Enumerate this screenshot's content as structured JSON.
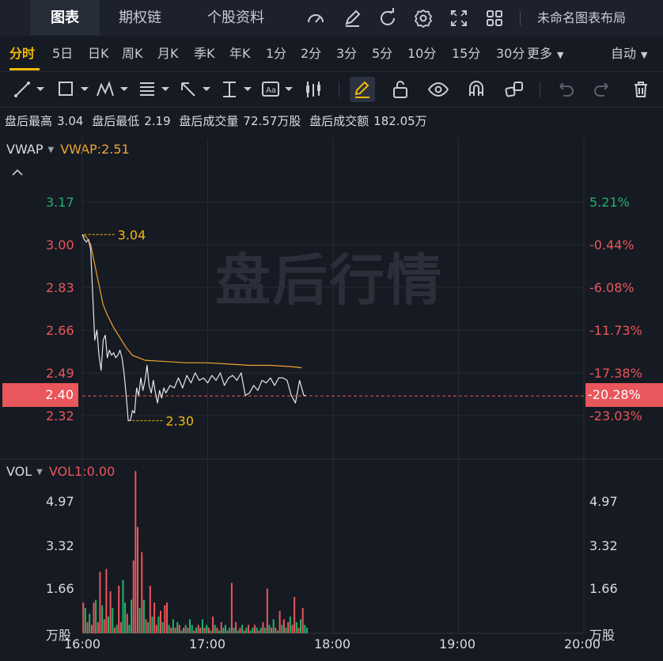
{
  "tabs": [
    {
      "label": "图表",
      "active": true
    },
    {
      "label": "期权链",
      "active": false
    },
    {
      "label": "个股资料",
      "active": false
    }
  ],
  "layout_name": "未命名图表布局",
  "periods": [
    "分时",
    "5日",
    "日K",
    "周K",
    "月K",
    "季K",
    "年K",
    "1分",
    "2分",
    "3分",
    "5分",
    "10分",
    "15分",
    "30分",
    "更多"
  ],
  "active_period": "分时",
  "mode_label": "自动",
  "info": {
    "high_label": "盘后最高",
    "high": "3.04",
    "low_label": "盘后最低",
    "low": "2.19",
    "vol_label": "盘后成交量",
    "vol": "72.57万股",
    "amt_label": "盘后成交额",
    "amt": "182.05万"
  },
  "watermark": "盘后行情",
  "price_legend": {
    "name": "VWAP",
    "value_text": "VWAP:2.51"
  },
  "vol_legend": {
    "name": "VOL",
    "value_text": "VOL1:0.00"
  },
  "colors": {
    "up": "#e9565b",
    "down": "#20b26c",
    "vwap": "#f0a330",
    "price": "#e6e6e6",
    "accent": "#f0b90b"
  },
  "chart_data": [
    {
      "type": "line",
      "title": "",
      "x_range": [
        "16:00",
        "20:00"
      ],
      "x_ticks": [
        "16:00",
        "17:00",
        "18:00",
        "19:00",
        "20:00"
      ],
      "y_ticks_left": [
        "3.17",
        "3.00",
        "2.83",
        "2.66",
        "2.49",
        "2.32"
      ],
      "y_ticks_right": [
        "5.21%",
        "-0.44%",
        "-6.08%",
        "-11.73%",
        "-17.38%",
        "-23.03%"
      ],
      "ylim": [
        2.23,
        3.31
      ],
      "current_price": "2.40",
      "current_pct": "-20.28%",
      "high_marker": {
        "time": "16:01",
        "value": 3.04,
        "label": "3.04"
      },
      "low_marker": {
        "time": "16:24",
        "value": 2.3,
        "label": "2.30"
      },
      "series": [
        {
          "name": "VWAP",
          "x": [
            "16:00",
            "16:02",
            "16:04",
            "16:06",
            "16:08",
            "16:10",
            "16:12",
            "16:15",
            "16:18",
            "16:21",
            "16:24",
            "16:30",
            "16:40",
            "16:50",
            "17:00",
            "17:10",
            "17:20",
            "17:30",
            "17:40",
            "17:45"
          ],
          "values": [
            3.04,
            3.03,
            3.0,
            2.92,
            2.84,
            2.76,
            2.72,
            2.67,
            2.63,
            2.59,
            2.56,
            2.54,
            2.535,
            2.53,
            2.53,
            2.525,
            2.52,
            2.52,
            2.515,
            2.51
          ]
        },
        {
          "name": "价格",
          "x": [
            "16:00",
            "16:01",
            "16:02",
            "16:03",
            "16:04",
            "16:05",
            "16:06",
            "16:07",
            "16:08",
            "16:09",
            "16:10",
            "16:11",
            "16:12",
            "16:13",
            "16:14",
            "16:15",
            "16:16",
            "16:17",
            "16:18",
            "16:19",
            "16:20",
            "16:21",
            "16:22",
            "16:23",
            "16:24",
            "16:25",
            "16:26",
            "16:27",
            "16:28",
            "16:29",
            "16:30",
            "16:31",
            "16:32",
            "16:33",
            "16:34",
            "16:35",
            "16:36",
            "16:37",
            "16:38",
            "16:39",
            "16:40",
            "16:42",
            "16:44",
            "16:46",
            "16:48",
            "16:50",
            "16:52",
            "16:54",
            "16:56",
            "16:58",
            "17:00",
            "17:02",
            "17:04",
            "17:06",
            "17:08",
            "17:10",
            "17:12",
            "17:14",
            "17:16",
            "17:18",
            "17:20",
            "17:22",
            "17:24",
            "17:26",
            "17:28",
            "17:30",
            "17:32",
            "17:34",
            "17:36",
            "17:38",
            "17:40",
            "17:42",
            "17:44",
            "17:46",
            "17:47"
          ],
          "values": [
            3.04,
            3.02,
            3.01,
            3.02,
            2.98,
            2.8,
            2.62,
            2.66,
            2.56,
            2.5,
            2.62,
            2.64,
            2.55,
            2.58,
            2.56,
            2.57,
            2.55,
            2.56,
            2.58,
            2.55,
            2.49,
            2.4,
            2.3,
            2.3,
            2.34,
            2.33,
            2.43,
            2.4,
            2.47,
            2.42,
            2.46,
            2.52,
            2.44,
            2.41,
            2.46,
            2.41,
            2.37,
            2.42,
            2.39,
            2.43,
            2.41,
            2.44,
            2.43,
            2.47,
            2.43,
            2.48,
            2.45,
            2.49,
            2.46,
            2.47,
            2.45,
            2.48,
            2.46,
            2.49,
            2.44,
            2.47,
            2.48,
            2.46,
            2.49,
            2.4,
            2.41,
            2.44,
            2.42,
            2.46,
            2.45,
            2.47,
            2.44,
            2.47,
            2.47,
            2.46,
            2.4,
            2.37,
            2.46,
            2.4,
            2.4
          ]
        }
      ]
    },
    {
      "type": "bar",
      "title": "",
      "unit": "万股",
      "y_ticks": [
        "4.97",
        "3.32",
        "1.66"
      ],
      "ylim": [
        0,
        6.0
      ],
      "x_range": [
        "16:00",
        "20:00"
      ],
      "series": [
        {
          "name": "VOL",
          "start": "16:00",
          "interval_min": 1,
          "values": [
            1.1,
            0.9,
            0.4,
            0.7,
            0.3,
            1.1,
            1.2,
            0.4,
            2.2,
            1.0,
            0.5,
            2.3,
            0.6,
            1.5,
            0.9,
            0.2,
            0.3,
            1.7,
            0.4,
            1.9,
            1.1,
            0.7,
            0.3,
            1.2,
            2.6,
            5.8,
            3.8,
            0.9,
            2.9,
            1.2,
            0.5,
            0.4,
            1.7,
            0.6,
            1.1,
            0.3,
            0.6,
            0.8,
            0.4,
            1.0,
            1.1,
            0.3,
            0.2,
            0.5,
            0.2,
            0.4,
            0.3,
            0.1,
            0.2,
            0.3,
            0.2,
            0.5,
            0.3,
            0.1,
            0.2,
            0.3,
            0.2,
            0.5,
            0.2,
            0.3,
            0.2,
            0.1,
            0.6,
            0.3,
            0.2,
            0.1,
            0.4,
            0.2,
            0.3,
            0.1,
            0.2,
            1.8,
            0.2,
            0.4,
            0.1,
            0.2,
            0.3,
            0.1,
            0.2,
            0.3,
            0.1,
            0.2,
            0.3,
            0.2,
            0.1,
            0.2,
            0.4,
            0.2,
            1.6,
            0.3,
            0.2,
            0.5,
            0.2,
            0.1,
            0.8,
            0.3,
            0.5,
            0.2,
            0.4,
            0.6,
            0.3,
            1.3,
            0.4,
            0.2,
            0.5,
            0.9,
            0.3,
            0.2
          ],
          "up": [
            1,
            0,
            1,
            0,
            1,
            1,
            0,
            1,
            1,
            0,
            1,
            1,
            0,
            1,
            0,
            1,
            0,
            1,
            1,
            0,
            0,
            1,
            0,
            0,
            1,
            1,
            1,
            0,
            1,
            0,
            1,
            0,
            1,
            0,
            1,
            1,
            0,
            1,
            0,
            1,
            1,
            0,
            1,
            0,
            1,
            0,
            1,
            0,
            1,
            0,
            1,
            0,
            0,
            1,
            0,
            1,
            1,
            0,
            1,
            0,
            1,
            0,
            1,
            0,
            1,
            0,
            1,
            0,
            0,
            1,
            0,
            1,
            0,
            1,
            0,
            1,
            0,
            1,
            0,
            1,
            0,
            0,
            1,
            0,
            1,
            0,
            1,
            0,
            1,
            0,
            1,
            0,
            1,
            0,
            1,
            0,
            1,
            0,
            1,
            0,
            1,
            1,
            0,
            1,
            0,
            1,
            0,
            0
          ]
        }
      ]
    }
  ]
}
